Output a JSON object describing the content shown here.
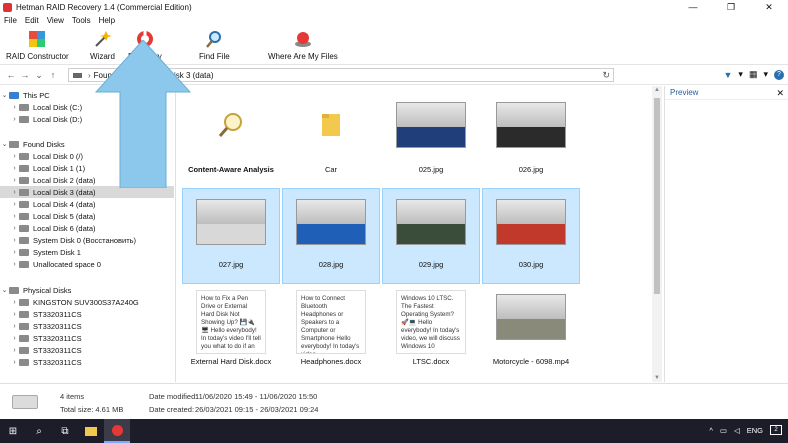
{
  "window": {
    "title": "Hetman RAID Recovery 1.4 (Commercial Edition)",
    "min": "—",
    "max": "❐",
    "close": "✕"
  },
  "menu": [
    "File",
    "Edit",
    "View",
    "Tools",
    "Help"
  ],
  "toolbar": {
    "raid_constructor": "RAID Constructor",
    "wizard": "Wizard",
    "recovery": "Recovery",
    "find_file": "Find File",
    "where_are_my_files": "Where Are My Files"
  },
  "address": {
    "crumb1": "Found Disks",
    "crumb2": "Local Disk 3 (data)"
  },
  "tree": {
    "this_pc": "This PC",
    "local_c": "Local Disk (C:)",
    "local_d": "Local Disk (D:)",
    "found_disks": "Found Disks",
    "found": [
      "Local Disk 0 (/)",
      "Local Disk 1 (1)",
      "Local Disk 2 (data)",
      "Local Disk 3 (data)",
      "Local Disk 4 (data)",
      "Local Disk 5 (data)",
      "Local Disk 6 (data)",
      "System Disk 0 (Восстановить)",
      "System Disk 1",
      "Unallocated space 0"
    ],
    "physical_disks": "Physical Disks",
    "physical": [
      "KINGSTON SUV300S37A240G",
      "ST3320311CS",
      "ST3320311CS",
      "ST3320311CS",
      "ST3320311CS",
      "ST3320311CS"
    ]
  },
  "files": [
    {
      "name": "Content-Aware Analysis",
      "kind": "search",
      "selected": false
    },
    {
      "name": "Car",
      "kind": "folder",
      "selected": false
    },
    {
      "name": "025.jpg",
      "kind": "photo",
      "color": "#1f3e7a",
      "selected": false
    },
    {
      "name": "026.jpg",
      "kind": "photo",
      "color": "#2b2b2b",
      "selected": false
    },
    {
      "name": "027.jpg",
      "kind": "photo",
      "color": "#d8d8d8",
      "selected": true
    },
    {
      "name": "028.jpg",
      "kind": "photo",
      "color": "#1f5fb8",
      "selected": true
    },
    {
      "name": "029.jpg",
      "kind": "photo",
      "color": "#3a4d3a",
      "selected": true
    },
    {
      "name": "030.jpg",
      "kind": "photo",
      "color": "#c0392b",
      "selected": true
    },
    {
      "name": "External Hard Disk.docx",
      "kind": "doc",
      "preview": "How to Fix a Pen Drive or External Hard Disk Not Showing Up? 💾🔌🖥 Hello everybody! In today's video I'll tell you what to do if an",
      "selected": false
    },
    {
      "name": "Headphones.docx",
      "kind": "doc",
      "preview": "How to Connect Bluetooth Headphones or Speakers to a Computer or Smartphone Hello everybody! In today's video,",
      "selected": false
    },
    {
      "name": "LTSC.docx",
      "kind": "doc",
      "preview": "Windows 10 LTSC. The Fastest Operating System? 🚀💻 Hello everybody! In today's video, we will discuss Windows 10",
      "selected": false
    },
    {
      "name": "Motorcycle - 6098.mp4",
      "kind": "video",
      "color": "#8a8a7a",
      "selected": false
    }
  ],
  "preview": {
    "title": "Preview",
    "close": "✕"
  },
  "status": {
    "items": "4 items",
    "total_size": "Total size: 4.61 MB",
    "modified_label": "Date modified:",
    "modified": "11/06/2020 15:49 - 11/06/2020 15:50",
    "created_label": "Date created:",
    "created": "26/03/2021 09:15 - 26/03/2021 09:24"
  },
  "taskbar": {
    "lang": "ENG",
    "notif": "2"
  },
  "colors": {
    "selection": "#cce8ff",
    "arrow": "#8cc8ec",
    "taskbar": "#1d1d2a"
  }
}
